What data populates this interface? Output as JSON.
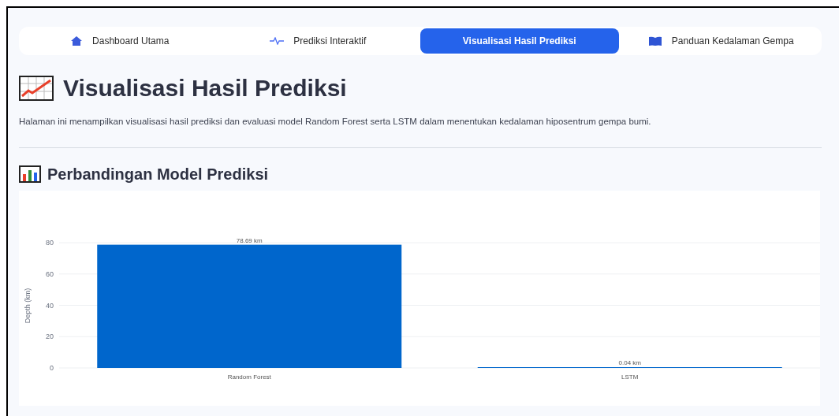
{
  "tabs": [
    {
      "label": "Dashboard Utama",
      "selected": false
    },
    {
      "label": "Prediksi Interaktif",
      "selected": false
    },
    {
      "label": "Visualisasi Hasil Prediksi",
      "selected": true
    },
    {
      "label": "Panduan Kedalaman Gempa",
      "selected": false
    }
  ],
  "title": "Visualisasi Hasil Prediksi",
  "description": "Halaman ini menampilkan visualisasi hasil prediksi dan evaluasi model Random Forest serta LSTM dalam menentukan kedalaman hiposentrum gempa bumi.",
  "section": {
    "title": "Perbandingan Model Prediksi",
    "chart_data": {
      "type": "bar",
      "ylabel": "Depth (km)",
      "categories": [
        "Random Forest",
        "LSTM"
      ],
      "series": [
        {
          "color": "#0066cc",
          "values": [
            78.69,
            0.04
          ]
        }
      ],
      "grid": true,
      "value_labels": [
        "78.69 km",
        "0.04 km"
      ],
      "ylim": [
        0,
        80
      ],
      "yticks": [
        0,
        20,
        40,
        60,
        80
      ]
    }
  }
}
